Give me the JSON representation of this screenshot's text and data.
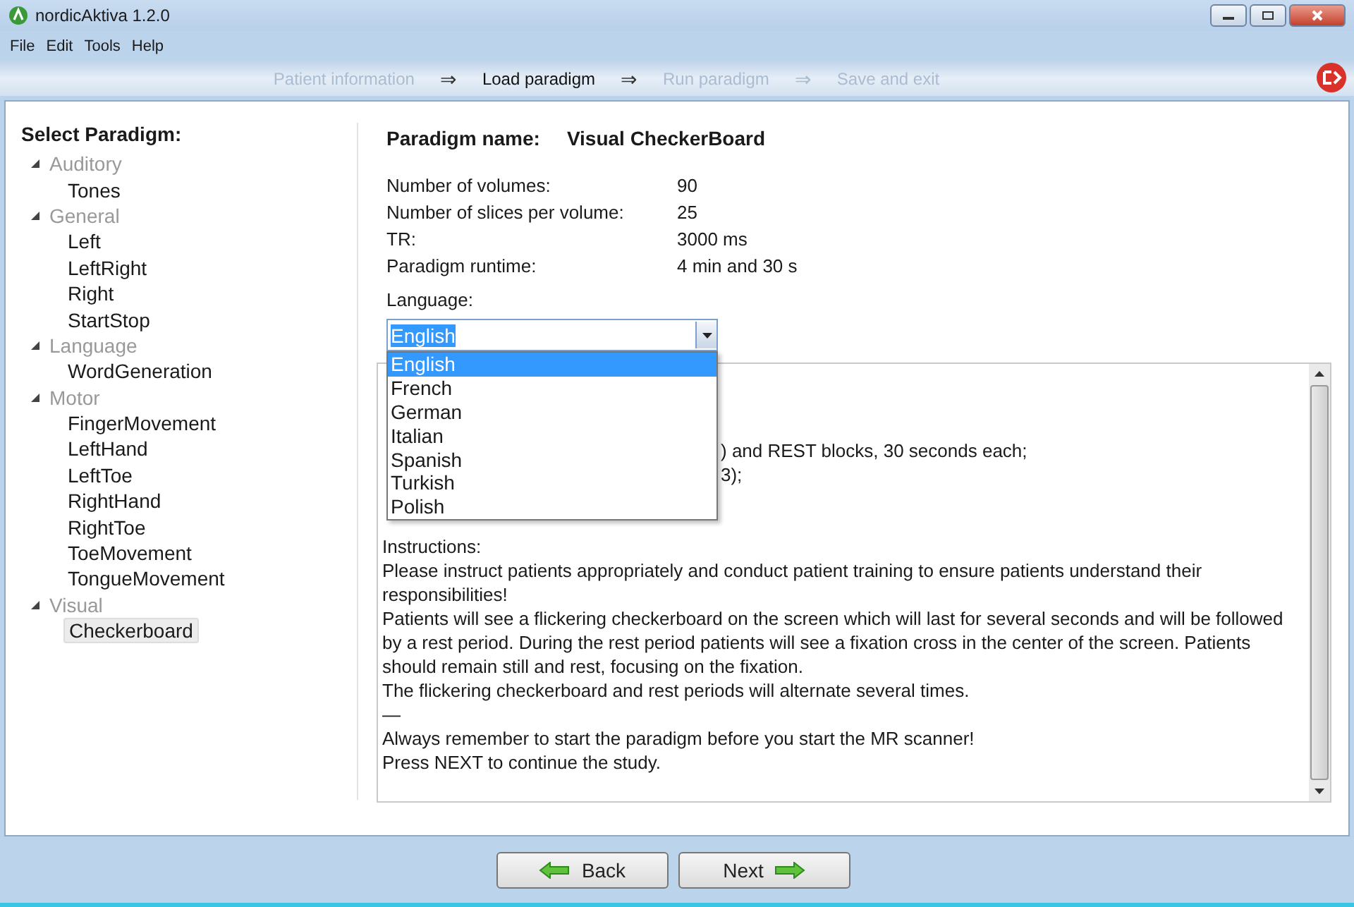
{
  "window": {
    "title": "nordicAktiva 1.2.0"
  },
  "menu": [
    "File",
    "Edit",
    "Tools",
    "Help"
  ],
  "steps": [
    {
      "label": "Patient information",
      "selected": false
    },
    {
      "label": "Load paradigm",
      "selected": true
    },
    {
      "label": "Run paradigm",
      "selected": false
    },
    {
      "label": "Save and exit",
      "selected": false
    }
  ],
  "step_arrows": [
    "⇒",
    "⇒",
    "⇒"
  ],
  "sidebar": {
    "title": "Select Paradigm:",
    "items": [
      {
        "label": "Auditory",
        "expanded": true,
        "children": [
          {
            "label": "Tones",
            "selected": false
          }
        ]
      },
      {
        "label": "General",
        "expanded": true,
        "children": [
          {
            "label": "Left",
            "selected": false
          },
          {
            "label": "LeftRight",
            "selected": false
          },
          {
            "label": "Right",
            "selected": false
          },
          {
            "label": "StartStop",
            "selected": false
          }
        ]
      },
      {
        "label": "Language",
        "expanded": true,
        "children": [
          {
            "label": "WordGeneration",
            "selected": false
          }
        ]
      },
      {
        "label": "Motor",
        "expanded": true,
        "children": [
          {
            "label": "FingerMovement",
            "selected": false
          },
          {
            "label": "LeftHand",
            "selected": false
          },
          {
            "label": "LeftToe",
            "selected": false
          },
          {
            "label": "RightHand",
            "selected": false
          },
          {
            "label": "RightToe",
            "selected": false
          },
          {
            "label": "ToeMovement",
            "selected": false
          },
          {
            "label": "TongueMovement",
            "selected": false
          }
        ]
      },
      {
        "label": "Visual",
        "expanded": true,
        "children": [
          {
            "label": "Checkerboard",
            "selected": true
          }
        ]
      }
    ]
  },
  "paradigm": {
    "name_label": "Paradigm name:",
    "name": "Visual CheckerBoard",
    "properties": [
      {
        "label": "Number of volumes:",
        "value": "90"
      },
      {
        "label": "Number of slices per volume:",
        "value": "25"
      },
      {
        "label": "TR:",
        "value": "3000 ms"
      },
      {
        "label": "Paradigm runtime:",
        "value": "4 min and 30 s"
      }
    ],
    "language_label": "Language:",
    "language": {
      "value": "English",
      "options": [
        {
          "label": "English",
          "selected": true
        },
        {
          "label": "French",
          "selected": false
        },
        {
          "label": "German",
          "selected": false
        },
        {
          "label": "Italian",
          "selected": false
        },
        {
          "label": "Spanish",
          "selected": false
        },
        {
          "label": "Turkish",
          "selected": false
        },
        {
          "label": "Polish",
          "selected": false
        }
      ]
    }
  },
  "description": {
    "fragments": [
      ") and REST blocks, 30 seconds each;",
      "3);"
    ],
    "lines": [
      {
        "left": "Instructions:"
      },
      {
        "left": "Please instruct patients appropriately and conduct patient training to ensure patients understand their"
      },
      {
        "left": "responsibilities!"
      },
      {
        "left": "Patients will see a flickering checkerboard on the screen which will last for several seconds and will be followed"
      },
      {
        "left": "by a rest period. During the rest period patients will see a fixation cross in the center of the screen. Patients"
      },
      {
        "left": "should remain still and rest, focusing on the fixation."
      },
      {
        "left": "The flickering checkerboard and rest periods will alternate several times."
      },
      {
        "left": "—"
      },
      {
        "left": "Always remember to start the paradigm before you start the MR scanner!"
      },
      {
        "left": "Press NEXT to continue the study."
      }
    ]
  },
  "buttons": [
    {
      "label": "Back",
      "kind": "back"
    },
    {
      "label": "Next",
      "kind": "next"
    }
  ]
}
